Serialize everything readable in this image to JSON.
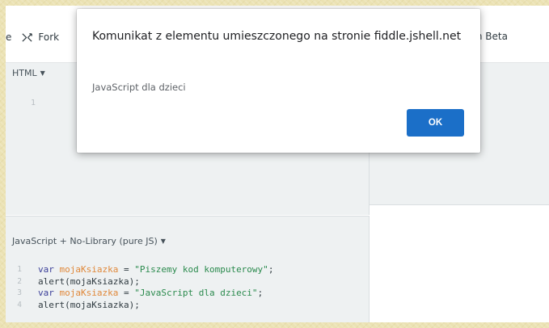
{
  "topbar": {
    "cut_label": "e",
    "fork_label": "Fork",
    "beta_label": ") in Beta"
  },
  "panes": {
    "html_header": "HTML",
    "html_line_numbers": [
      "1"
    ],
    "js_header": "JavaScript + No-Library (pure JS)"
  },
  "code": {
    "lines": [
      {
        "num": "1",
        "kw": "var ",
        "var": "mojaKsiazka",
        "op": " = ",
        "str": "\"Piszemy kod komputerowy\"",
        "end": ";"
      },
      {
        "num": "2",
        "plain": "alert(mojaKsiazka);"
      },
      {
        "num": "3",
        "kw": "var ",
        "var": "mojaKsiazka",
        "op": " = ",
        "str": "\"JavaScript dla dzieci\"",
        "end": ";"
      },
      {
        "num": "4",
        "plain": "alert(mojaKsiazka);"
      }
    ]
  },
  "dialog": {
    "title": "Komunikat z elementu umieszczonego na stronie fiddle.jshell.net",
    "message": "JavaScript dla dzieci",
    "ok_label": "OK"
  },
  "colors": {
    "accent": "#1b6fc8",
    "keyword": "#3b3f99",
    "variable": "#e0883a",
    "string": "#2a8a4d"
  },
  "icons": {
    "fork": "fork-icon",
    "caret": "caret-down-icon"
  }
}
